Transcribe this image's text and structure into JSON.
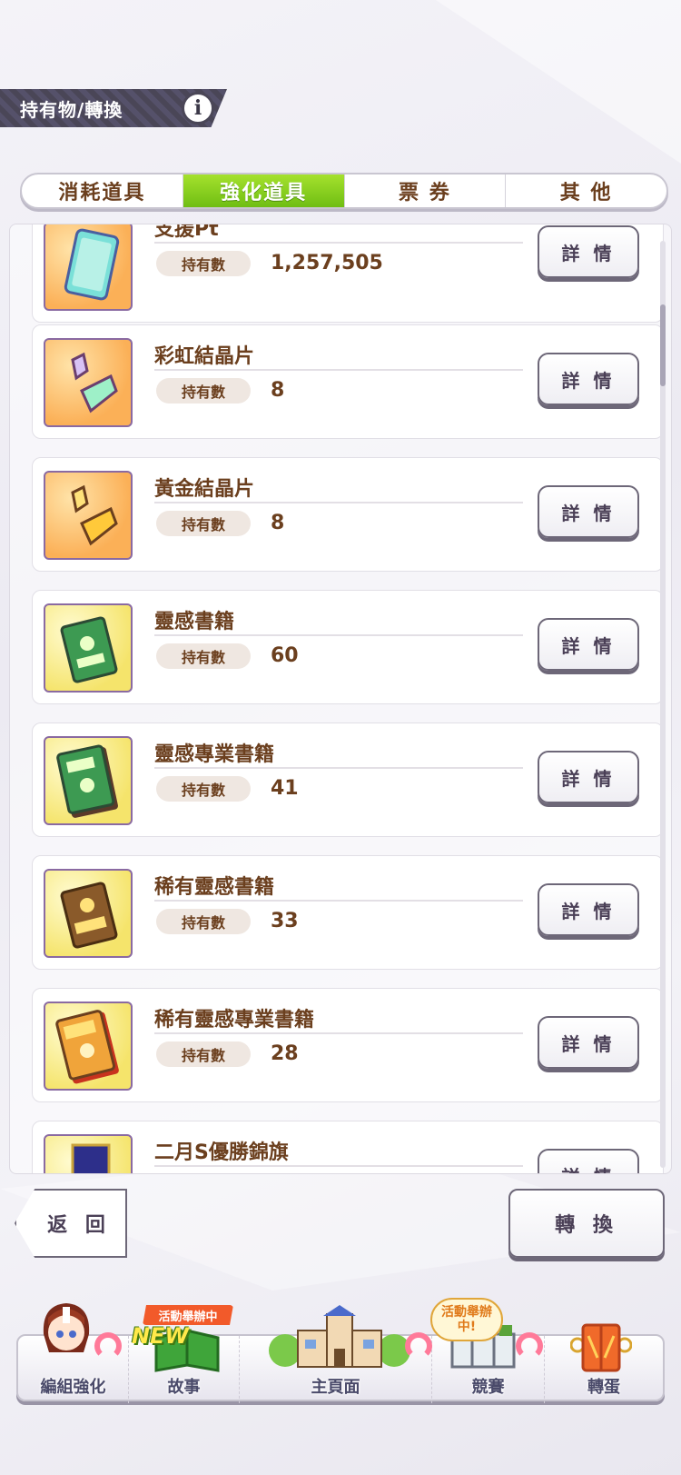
{
  "header": {
    "title": "持有物/轉換",
    "info_glyph": "i"
  },
  "tabs": [
    {
      "label": "消耗道具",
      "active": false
    },
    {
      "label": "強化道具",
      "active": true
    },
    {
      "label": "票 券",
      "active": false
    },
    {
      "label": "其 他",
      "active": false
    }
  ],
  "item_labels": {
    "own_label": "持有數",
    "detail_label": "詳 情"
  },
  "items": [
    {
      "name": "支援Pt",
      "count": "1,257,505",
      "icon": "support-pt-card-icon"
    },
    {
      "name": "彩虹結晶片",
      "count": "8",
      "icon": "rainbow-crystal-shard-icon"
    },
    {
      "name": "黃金結晶片",
      "count": "8",
      "icon": "gold-crystal-shard-icon"
    },
    {
      "name": "靈感書籍",
      "count": "60",
      "icon": "inspiration-book-icon"
    },
    {
      "name": "靈感專業書籍",
      "count": "41",
      "icon": "inspiration-pro-book-icon"
    },
    {
      "name": "稀有靈感書籍",
      "count": "33",
      "icon": "rare-inspiration-book-icon"
    },
    {
      "name": "稀有靈感專業書籍",
      "count": "28",
      "icon": "rare-inspiration-pro-book-icon"
    },
    {
      "name": "二月S優勝錦旗",
      "count": "",
      "icon": "pennant-icon"
    }
  ],
  "actions": {
    "back_label": "返 回",
    "convert_label": "轉 換"
  },
  "nav": {
    "items": [
      {
        "label": "編組強化",
        "icon": "character-avatar-icon"
      },
      {
        "label": "故事",
        "icon": "story-book-icon"
      },
      {
        "label": "主頁面",
        "icon": "school-building-icon"
      },
      {
        "label": "競賽",
        "icon": "race-gate-icon"
      },
      {
        "label": "轉蛋",
        "icon": "gacha-door-icon"
      }
    ],
    "story_badge": "活動舉辦中",
    "story_new": "NEW",
    "race_badge": "活動舉辦中!"
  },
  "colors": {
    "accent_green": "#7dc91b",
    "text_brown": "#6b3f1e",
    "header_dark": "#4a4657"
  }
}
